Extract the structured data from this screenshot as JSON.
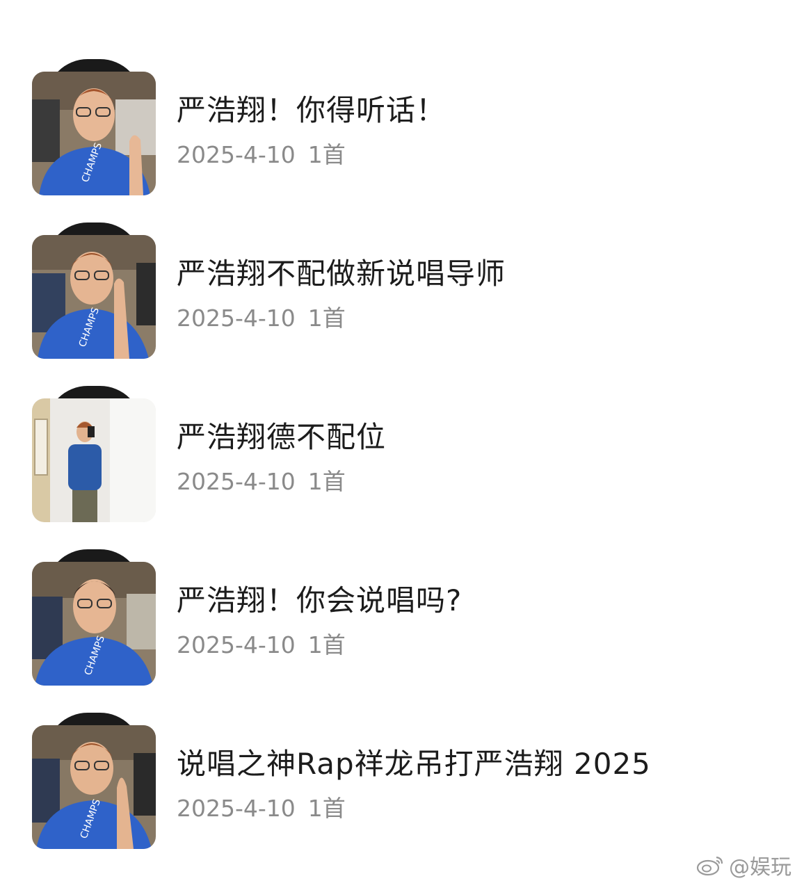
{
  "albums": [
    {
      "title": "严浩翔！你得听话！",
      "date": "2025-4-10",
      "count": "1首",
      "cover": "man-in-car-peace-sign"
    },
    {
      "title": "严浩翔不配做新说唱导师",
      "date": "2025-4-10",
      "count": "1首",
      "cover": "man-in-car-peace-sign"
    },
    {
      "title": "严浩翔德不配位",
      "date": "2025-4-10",
      "count": "1首",
      "cover": "man-mirror-selfie"
    },
    {
      "title": "严浩翔！你会说唱吗?",
      "date": "2025-4-10",
      "count": "1首",
      "cover": "man-in-car"
    },
    {
      "title": "说唱之神Rap祥龙吊打严浩翔 2025",
      "date": "2025-4-10",
      "count": "1首",
      "cover": "man-in-car-pointing"
    }
  ],
  "watermark": {
    "text": "@娱玩",
    "icon": "weibo-icon"
  },
  "colors": {
    "title": "#1c1c1c",
    "meta": "#8a8a8a",
    "shirt": "#2f62c9"
  }
}
